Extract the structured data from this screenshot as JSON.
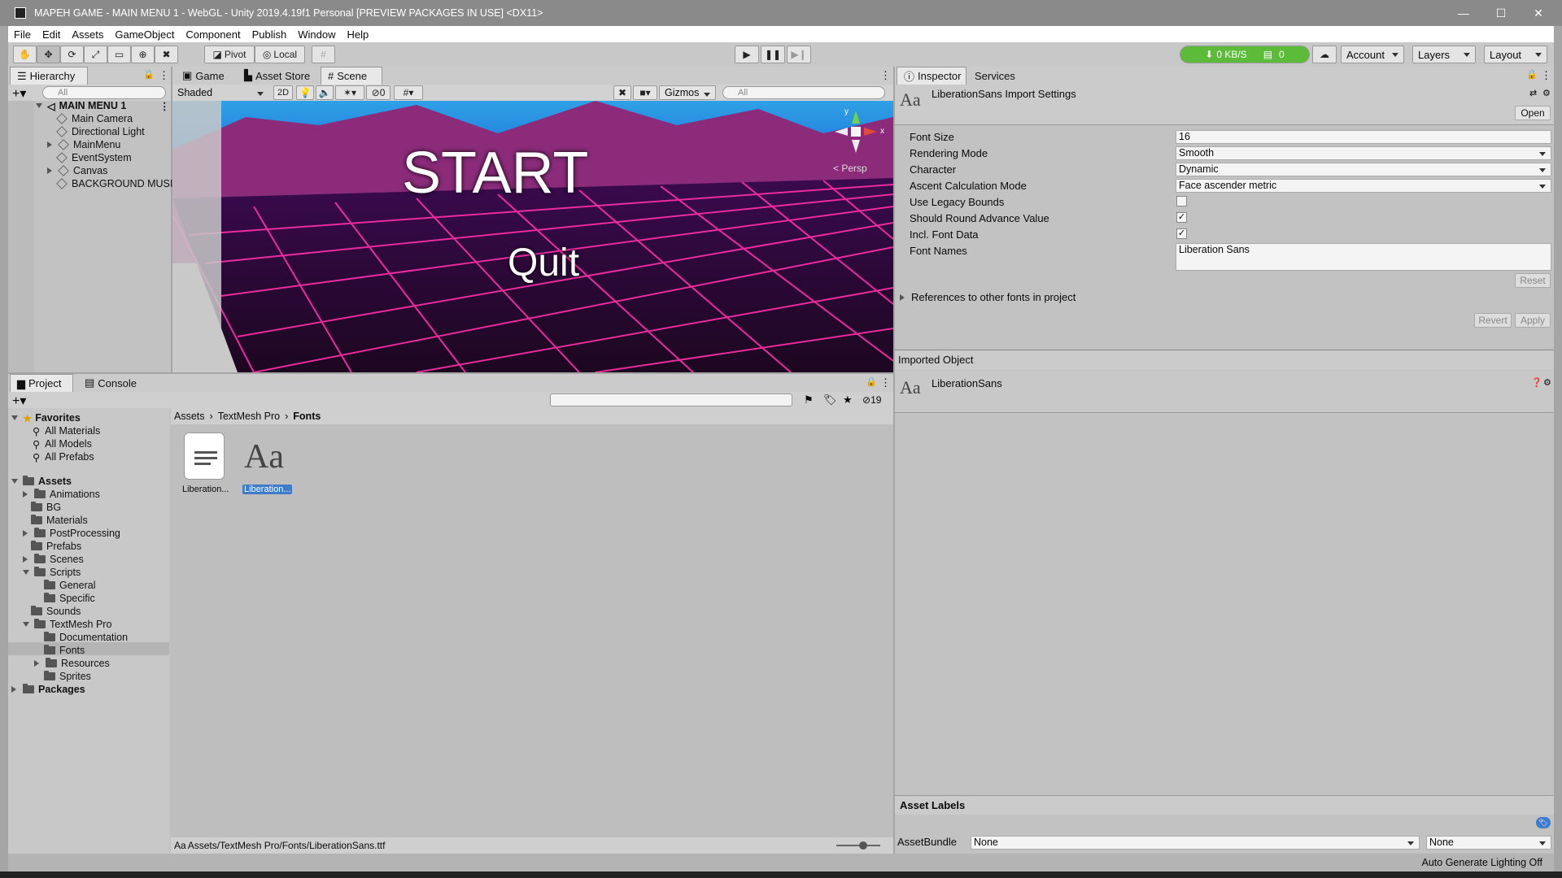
{
  "window": {
    "title": "MAPEH GAME - MAIN MENU 1 - WebGL - Unity 2019.4.19f1 Personal [PREVIEW PACKAGES IN USE] <DX11>",
    "minimize": "—",
    "maximize": "☐",
    "close": "✕"
  },
  "menu": [
    "File",
    "Edit",
    "Assets",
    "GameObject",
    "Component",
    "Publish",
    "Window",
    "Help"
  ],
  "toolbar": {
    "pivot": "Pivot",
    "local": "Local",
    "net_speed": "0 KB/S",
    "net_count": "0",
    "account": "Account",
    "layers": "Layers",
    "layout": "Layout"
  },
  "hierarchy": {
    "tab": "Hierarchy",
    "search_placeholder": "All",
    "scene": "MAIN MENU 1",
    "items": [
      "Main Camera",
      "Directional Light",
      "MainMenu",
      "EventSystem",
      "Canvas",
      "BACKGROUND MUSI"
    ]
  },
  "scene_tabs": {
    "game": "Game",
    "asset_store": "Asset Store",
    "scene": "Scene"
  },
  "scene_toolbar": {
    "shading": "Shaded",
    "mode_2d": "2D",
    "hidden_count": "0",
    "gizmos": "Gizmos",
    "search_placeholder": "All"
  },
  "scene_view": {
    "start_text": "START",
    "quit_text": "Quit",
    "persp": "< Persp",
    "axis_x": "x",
    "axis_y": "y"
  },
  "project": {
    "tab": "Project",
    "console_tab": "Console",
    "hidden_count": "19",
    "favorites_label": "Favorites",
    "favorites": [
      "All Materials",
      "All Models",
      "All Prefabs"
    ],
    "assets_label": "Assets",
    "assets": [
      "Animations",
      "BG",
      "Materials",
      "PostProcessing",
      "Prefabs",
      "Scenes",
      "Scripts",
      "General",
      "Specific",
      "Sounds",
      "TextMesh Pro",
      "Documentation",
      "Fonts",
      "Resources",
      "Sprites"
    ],
    "packages_label": "Packages",
    "breadcrumb": [
      "Assets",
      "TextMesh Pro",
      "Fonts"
    ],
    "files": [
      {
        "name": "Liberation...",
        "type": "text"
      },
      {
        "name": "Liberation...",
        "type": "font"
      }
    ],
    "font_glyph": "Aa",
    "status_path": "Assets/TextMesh Pro/Fonts/LiberationSans.ttf"
  },
  "inspector": {
    "tab": "Inspector",
    "services_tab": "Services",
    "header_icon": "Aa",
    "title": "LiberationSans Import Settings",
    "open_btn": "Open",
    "fields": {
      "font_size_label": "Font Size",
      "font_size": "16",
      "rendering_mode_label": "Rendering Mode",
      "rendering_mode": "Smooth",
      "character_label": "Character",
      "character": "Dynamic",
      "ascent_label": "Ascent Calculation Mode",
      "ascent": "Face ascender metric",
      "legacy_label": "Use Legacy Bounds",
      "legacy": false,
      "round_label": "Should Round Advance Value",
      "round": true,
      "incl_label": "Incl. Font Data",
      "incl": true,
      "names_label": "Font Names",
      "names": "Liberation Sans"
    },
    "reset_btn": "Reset",
    "references": "References to other fonts in project",
    "revert_btn": "Revert",
    "apply_btn": "Apply",
    "imported_object": "Imported Object",
    "imported_name": "LiberationSans",
    "asset_labels": "Asset Labels",
    "assetbundle_label": "AssetBundle",
    "assetbundle": "None",
    "variant": "None"
  },
  "status": {
    "lighting": "Auto Generate Lighting Off"
  },
  "colors": {
    "accent_green": "#5dbb3a",
    "selection_blue": "#3e7bc9",
    "grid_pink": "#ff2fa8"
  }
}
